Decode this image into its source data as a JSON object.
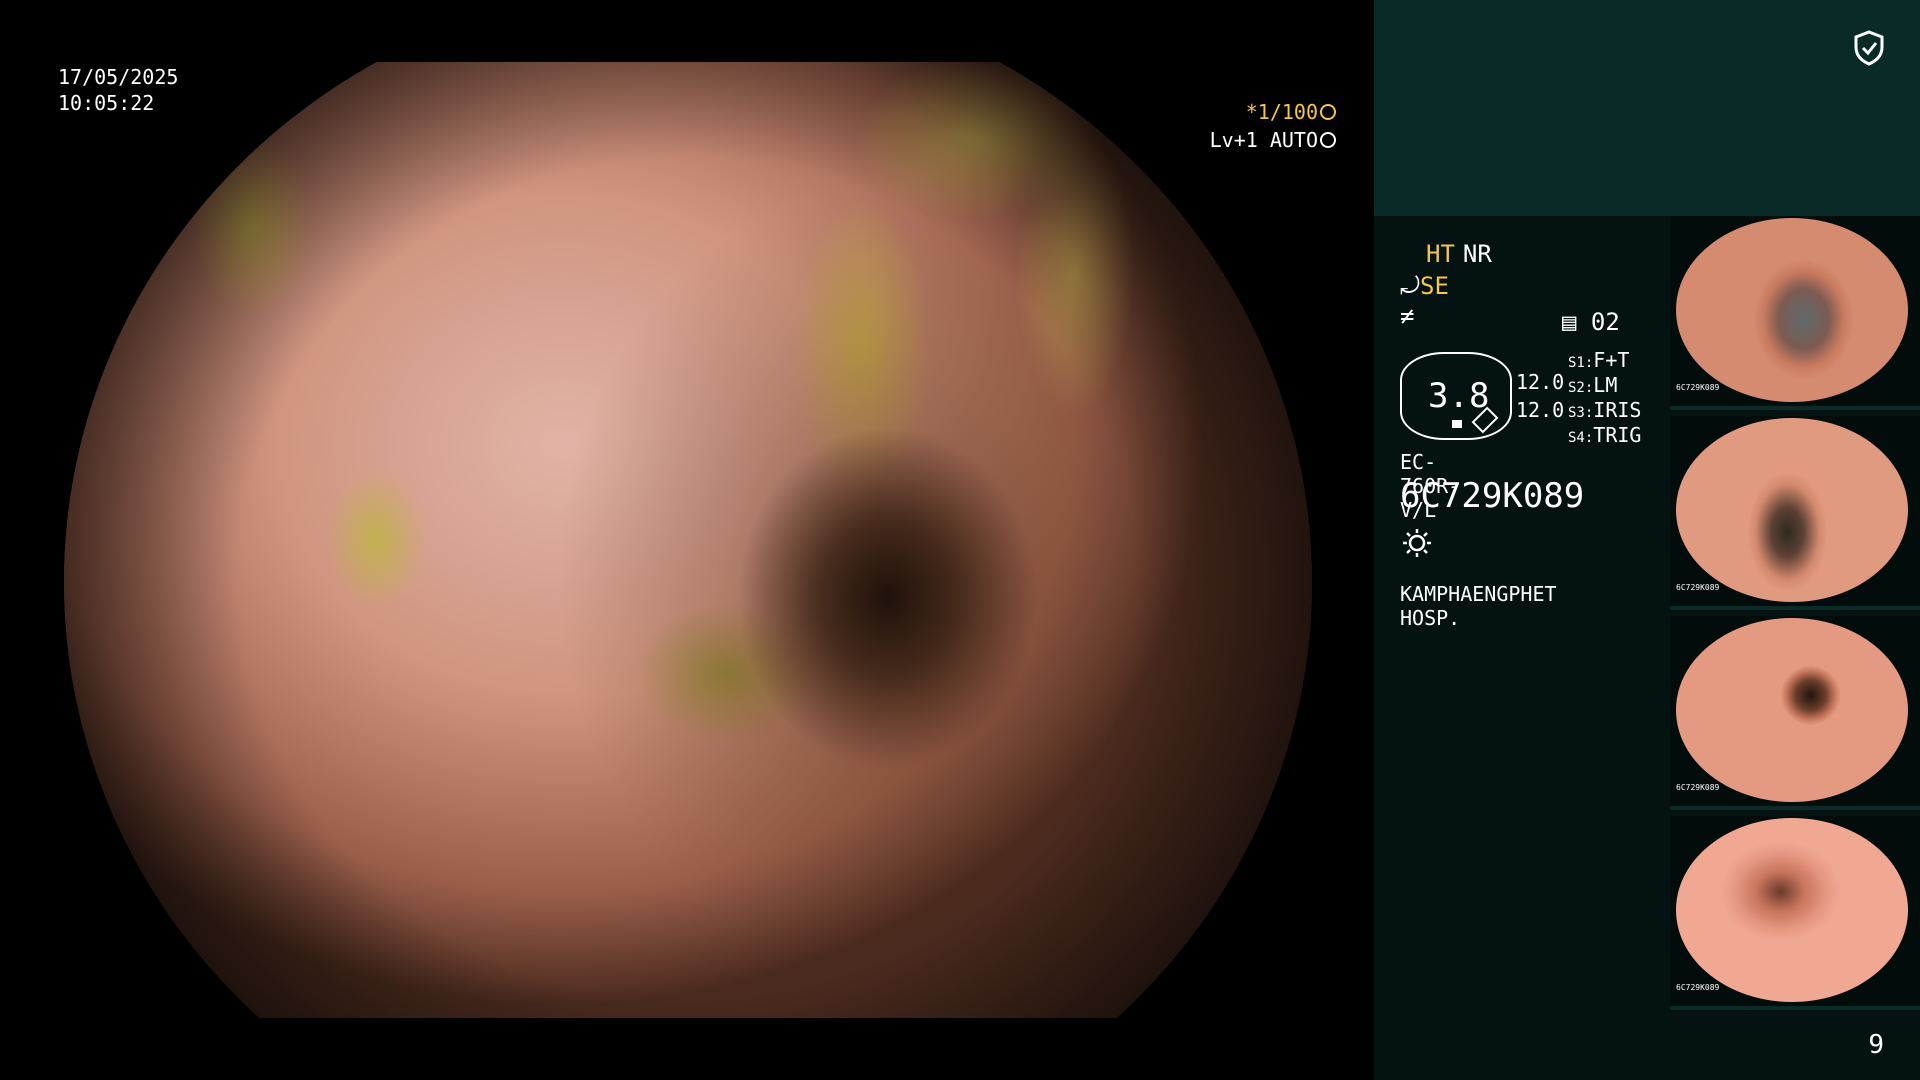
{
  "overlay": {
    "date": "17/05/2025",
    "time": "10:05:22",
    "shutter": "*1/100",
    "level": "Lv+1 AUTO"
  },
  "panel": {
    "ht": "HT",
    "nr": "NR",
    "se": "SE",
    "page": "02",
    "brightness_value": "3.8",
    "gain_1": "12.0",
    "gain_2": "12.0",
    "settings": [
      {
        "key": "S1:",
        "value": "F+T"
      },
      {
        "key": "S2:",
        "value": "LM"
      },
      {
        "key": "S3:",
        "value": "IRIS"
      },
      {
        "key": "S4:",
        "value": "TRIG"
      }
    ],
    "scope_model": "EC-760R-V/L",
    "scope_serial": "6C729K089",
    "hospital": "KAMPHAENGPHET HOSP."
  },
  "thumbnails": [
    {
      "label": "6C729K089"
    },
    {
      "label": "6C729K089"
    },
    {
      "label": "6C729K089"
    },
    {
      "label": "6C729K089"
    }
  ],
  "frame_count": "9",
  "colors": {
    "accent": "#f5c64a",
    "panel_bg": "#041211",
    "panel_top_bg": "#0a2a28"
  },
  "icons": {
    "shield": "shield-check-icon",
    "light": "sun-icon",
    "shutter": "shutter-icon",
    "auto": "auto-iris-icon",
    "page": "page-icon"
  }
}
